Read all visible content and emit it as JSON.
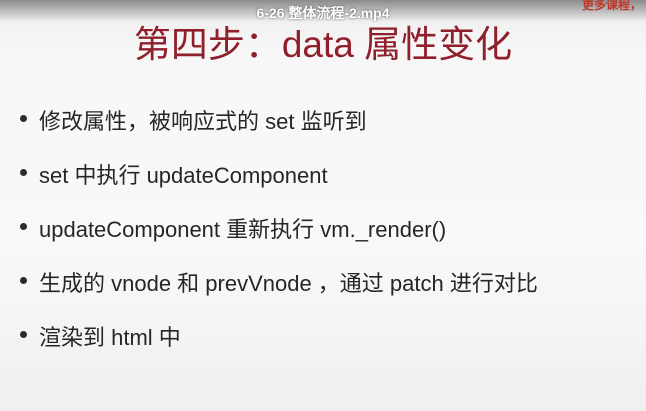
{
  "video": {
    "title": "6-26 整体流程-2.mp4",
    "corner_text": "更多课程，"
  },
  "slide": {
    "title": "第四步：data 属性变化",
    "bullets": [
      {
        "text": "修改属性，被响应式的 set 监听到"
      },
      {
        "text": "set 中执行 updateComponent"
      },
      {
        "text": "updateComponent 重新执行 vm._render()"
      },
      {
        "text": "生成的 vnode 和 prevVnode ，通过 patch 进行对比"
      },
      {
        "text": "渲染到 html 中"
      }
    ]
  },
  "colors": {
    "title": "#8e1f2b",
    "body_text": "#262626",
    "background": "#f7f7f7"
  }
}
